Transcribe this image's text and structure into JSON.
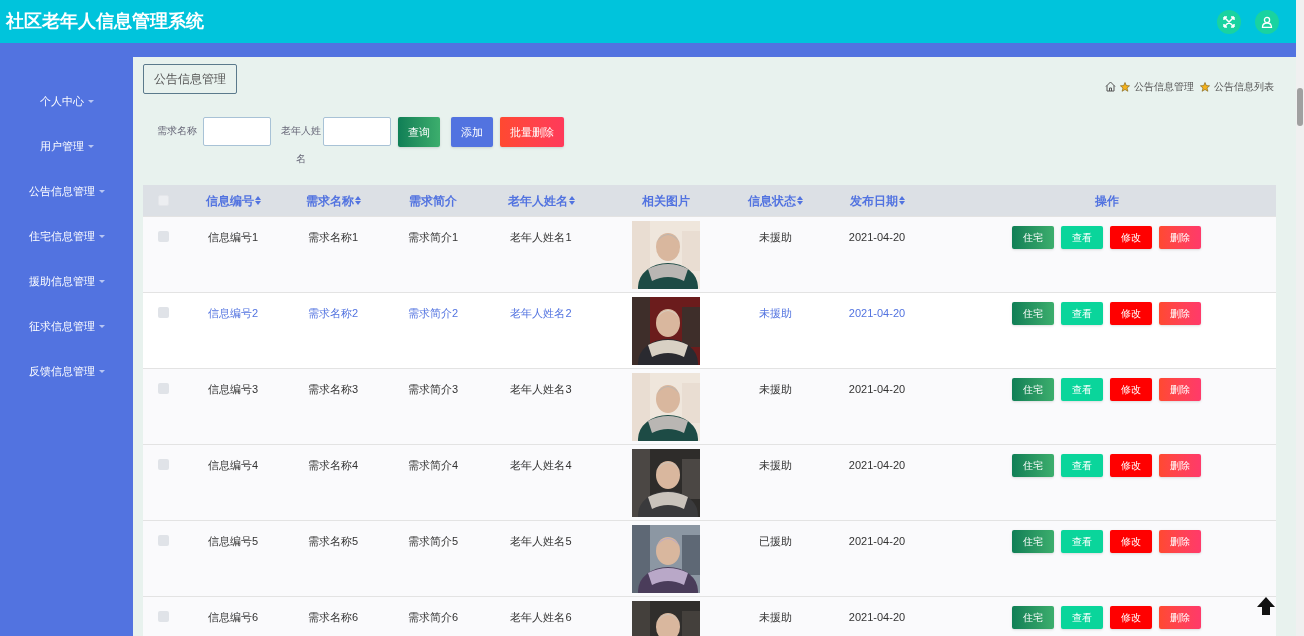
{
  "header": {
    "title": "社区老年人信息管理系统"
  },
  "sidebar": {
    "items": [
      {
        "label": "个人中心"
      },
      {
        "label": "用户管理"
      },
      {
        "label": "公告信息管理"
      },
      {
        "label": "住宅信息管理"
      },
      {
        "label": "援助信息管理"
      },
      {
        "label": "征求信息管理"
      },
      {
        "label": "反馈信息管理"
      }
    ]
  },
  "page_title": "公告信息管理",
  "breadcrumb": [
    "公告信息管理",
    "公告信息列表"
  ],
  "search": {
    "fields": [
      {
        "label": "需求名称"
      },
      {
        "label": "老年人姓名"
      }
    ],
    "buttons": [
      {
        "label": "查询",
        "kind": "search"
      },
      {
        "label": "添加",
        "kind": "add"
      },
      {
        "label": "批量删除",
        "kind": "delete"
      }
    ]
  },
  "table": {
    "select_all_checked": false,
    "columns": [
      {
        "label": "信息编号",
        "sortable": true
      },
      {
        "label": "需求名称",
        "sortable": true
      },
      {
        "label": "需求简介",
        "sortable": false
      },
      {
        "label": "老年人姓名",
        "sortable": true
      },
      {
        "label": "相关图片",
        "sortable": false
      },
      {
        "label": "信息状态",
        "sortable": true
      },
      {
        "label": "发布日期",
        "sortable": true
      },
      {
        "label": "操作",
        "sortable": false
      }
    ],
    "rows": [
      {
        "checked": false,
        "hovered": false,
        "cells": [
          "信息编号1",
          "需求名称1",
          "需求简介1",
          "老年人姓名1"
        ],
        "status": "未援助",
        "date": "2021-04-20",
        "actions": [
          {
            "label": "住宅",
            "kind": "house"
          },
          {
            "label": "查看",
            "kind": "view"
          },
          {
            "label": "修改",
            "kind": "edit"
          },
          {
            "label": "删除",
            "kind": "delete"
          }
        ]
      },
      {
        "checked": false,
        "hovered": true,
        "cells": [
          "信息编号2",
          "需求名称2",
          "需求简介2",
          "老年人姓名2"
        ],
        "status": "未援助",
        "date": "2021-04-20",
        "actions": [
          {
            "label": "住宅",
            "kind": "house"
          },
          {
            "label": "查看",
            "kind": "view"
          },
          {
            "label": "修改",
            "kind": "edit"
          },
          {
            "label": "删除",
            "kind": "delete"
          }
        ]
      },
      {
        "checked": false,
        "hovered": false,
        "cells": [
          "信息编号3",
          "需求名称3",
          "需求简介3",
          "老年人姓名3"
        ],
        "status": "未援助",
        "date": "2021-04-20",
        "actions": [
          {
            "label": "住宅",
            "kind": "house"
          },
          {
            "label": "查看",
            "kind": "view"
          },
          {
            "label": "修改",
            "kind": "edit"
          },
          {
            "label": "删除",
            "kind": "delete"
          }
        ]
      },
      {
        "checked": false,
        "hovered": false,
        "cells": [
          "信息编号4",
          "需求名称4",
          "需求简介4",
          "老年人姓名4"
        ],
        "status": "未援助",
        "date": "2021-04-20",
        "actions": [
          {
            "label": "住宅",
            "kind": "house"
          },
          {
            "label": "查看",
            "kind": "view"
          },
          {
            "label": "修改",
            "kind": "edit"
          },
          {
            "label": "删除",
            "kind": "delete"
          }
        ]
      },
      {
        "checked": false,
        "hovered": false,
        "cells": [
          "信息编号5",
          "需求名称5",
          "需求简介5",
          "老年人姓名5"
        ],
        "status": "已援助",
        "date": "2021-04-20",
        "actions": [
          {
            "label": "住宅",
            "kind": "house"
          },
          {
            "label": "查看",
            "kind": "view"
          },
          {
            "label": "修改",
            "kind": "edit"
          },
          {
            "label": "删除",
            "kind": "delete"
          }
        ]
      },
      {
        "checked": false,
        "hovered": false,
        "cells": [
          "信息编号6",
          "需求名称6",
          "需求简介6",
          "老年人姓名6"
        ],
        "status": "未援助",
        "date": "2021-04-20",
        "actions": [
          {
            "label": "住宅",
            "kind": "house"
          },
          {
            "label": "查看",
            "kind": "view"
          },
          {
            "label": "修改",
            "kind": "edit"
          },
          {
            "label": "删除",
            "kind": "delete"
          }
        ]
      }
    ]
  }
}
